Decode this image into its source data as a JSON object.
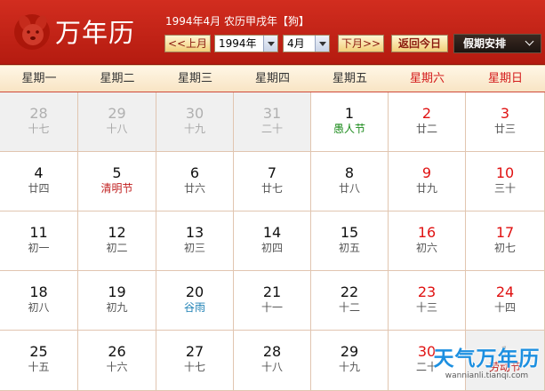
{
  "header": {
    "title": "万年历",
    "info": "1994年4月 农历甲戌年【狗】",
    "prev_label": "<<上月",
    "year_value": "1994年",
    "month_value": "4月",
    "next_label": "下月>>",
    "today_label": "返回今日",
    "holiday_label": "假期安排"
  },
  "weekdays": [
    "星期一",
    "星期二",
    "星期三",
    "星期四",
    "星期五",
    "星期六",
    "星期日"
  ],
  "weeks": [
    [
      {
        "day": "28",
        "lunar": "十七",
        "other": true
      },
      {
        "day": "29",
        "lunar": "十八",
        "other": true
      },
      {
        "day": "30",
        "lunar": "十九",
        "other": true
      },
      {
        "day": "31",
        "lunar": "二十",
        "other": true
      },
      {
        "day": "1",
        "lunar": "愚人节",
        "type": "green"
      },
      {
        "day": "2",
        "lunar": "廿二"
      },
      {
        "day": "3",
        "lunar": "廿三"
      }
    ],
    [
      {
        "day": "4",
        "lunar": "廿四"
      },
      {
        "day": "5",
        "lunar": "清明节",
        "type": "hol"
      },
      {
        "day": "6",
        "lunar": "廿六"
      },
      {
        "day": "7",
        "lunar": "廿七"
      },
      {
        "day": "8",
        "lunar": "廿八"
      },
      {
        "day": "9",
        "lunar": "廿九"
      },
      {
        "day": "10",
        "lunar": "三十"
      }
    ],
    [
      {
        "day": "11",
        "lunar": "初一"
      },
      {
        "day": "12",
        "lunar": "初二"
      },
      {
        "day": "13",
        "lunar": "初三"
      },
      {
        "day": "14",
        "lunar": "初四"
      },
      {
        "day": "15",
        "lunar": "初五"
      },
      {
        "day": "16",
        "lunar": "初六"
      },
      {
        "day": "17",
        "lunar": "初七"
      }
    ],
    [
      {
        "day": "18",
        "lunar": "初八"
      },
      {
        "day": "19",
        "lunar": "初九"
      },
      {
        "day": "20",
        "lunar": "谷雨",
        "type": "blue"
      },
      {
        "day": "21",
        "lunar": "十一"
      },
      {
        "day": "22",
        "lunar": "十二"
      },
      {
        "day": "23",
        "lunar": "十三"
      },
      {
        "day": "24",
        "lunar": "十四"
      }
    ],
    [
      {
        "day": "25",
        "lunar": "十五"
      },
      {
        "day": "26",
        "lunar": "十六"
      },
      {
        "day": "27",
        "lunar": "十七"
      },
      {
        "day": "28",
        "lunar": "十八"
      },
      {
        "day": "29",
        "lunar": "十九"
      },
      {
        "day": "30",
        "lunar": "二十"
      },
      {
        "day": "1",
        "lunar": "劳动节",
        "type": "hol",
        "other": true
      }
    ]
  ],
  "watermark": {
    "text": "天气万年历",
    "url": "wannianli.tianqi.com"
  },
  "colors": {
    "header_red": "#c8251a",
    "weekend_red": "#e01212",
    "holiday_red": "#c02020",
    "festival_green": "#1a8a1a",
    "solar_term_blue": "#1b7fb3"
  }
}
